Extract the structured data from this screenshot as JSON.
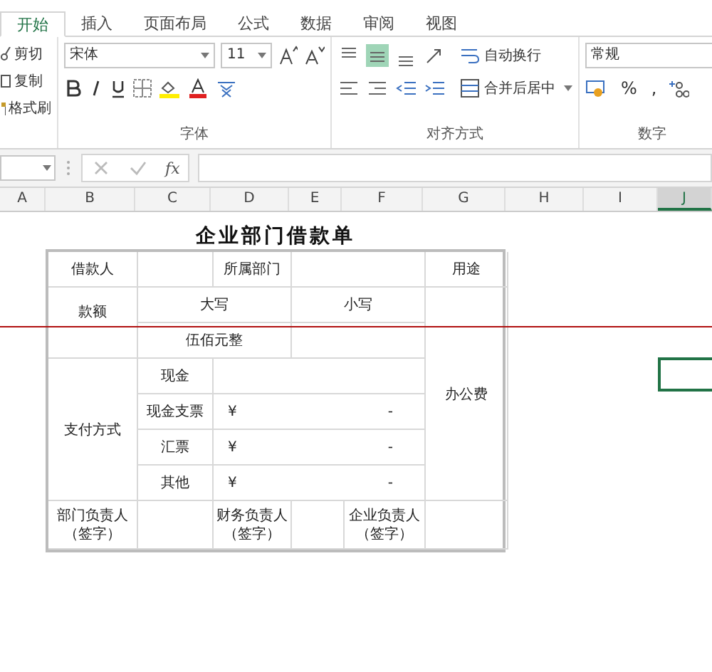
{
  "tabs": [
    {
      "label": "开始",
      "selected": true
    },
    {
      "label": "插入",
      "selected": false
    },
    {
      "label": "页面布局",
      "selected": false
    },
    {
      "label": "公式",
      "selected": false
    },
    {
      "label": "数据",
      "selected": false
    },
    {
      "label": "审阅",
      "selected": false
    },
    {
      "label": "视图",
      "selected": false
    }
  ],
  "clipboard": {
    "items": [
      {
        "label": "剪切",
        "kind": "cut"
      },
      {
        "label": "复制",
        "kind": "copy"
      },
      {
        "label": "格式刷",
        "kind": "painter"
      }
    ]
  },
  "font_group": {
    "font": "宋体",
    "size": "11",
    "label": "字体"
  },
  "alignment_group": {
    "valign": [
      {
        "selected": false
      },
      {
        "selected": true
      },
      {
        "selected": false
      }
    ],
    "wrap": "自动换行",
    "merge": "合并后居中",
    "label": "对齐方式"
  },
  "number_group": {
    "format": "常规",
    "percent": "%",
    "comma": ",",
    "label": "数字"
  },
  "formula_bar": {
    "fx": "fx"
  },
  "columns": [
    {
      "label": "A",
      "selected": false
    },
    {
      "label": "B",
      "selected": false
    },
    {
      "label": "C",
      "selected": false
    },
    {
      "label": "D",
      "selected": false
    },
    {
      "label": "E",
      "selected": false
    },
    {
      "label": "F",
      "selected": false
    },
    {
      "label": "G",
      "selected": false
    },
    {
      "label": "H",
      "selected": false
    },
    {
      "label": "I",
      "selected": false
    },
    {
      "label": "J",
      "selected": true
    }
  ],
  "form": {
    "title": "企业部门借款单",
    "borrower_label": "借款人",
    "department_label": "所属部门",
    "purpose_label": "用途",
    "amount_label": "款额",
    "uppercase_label": "大写",
    "lowercase_label": "小写",
    "uppercase_value": "伍佰元整",
    "purpose_value": "办公费",
    "payment_label": "支付方式",
    "payment_methods": [
      {
        "label": "现金",
        "kind": "plain"
      },
      {
        "label": "现金支票",
        "kind": "amount",
        "currency": "¥",
        "amount": "-"
      },
      {
        "label": "汇票",
        "kind": "amount",
        "currency": "¥",
        "amount": "-"
      },
      {
        "label": "其他",
        "kind": "amount",
        "currency": "¥",
        "amount": "-"
      }
    ],
    "signatures": [
      {
        "role": "部门负责人",
        "note": "（签字）"
      },
      {
        "role": "财务负责人",
        "note": "（签字）"
      },
      {
        "role": "企业负责人",
        "note": "（签字）"
      }
    ]
  }
}
